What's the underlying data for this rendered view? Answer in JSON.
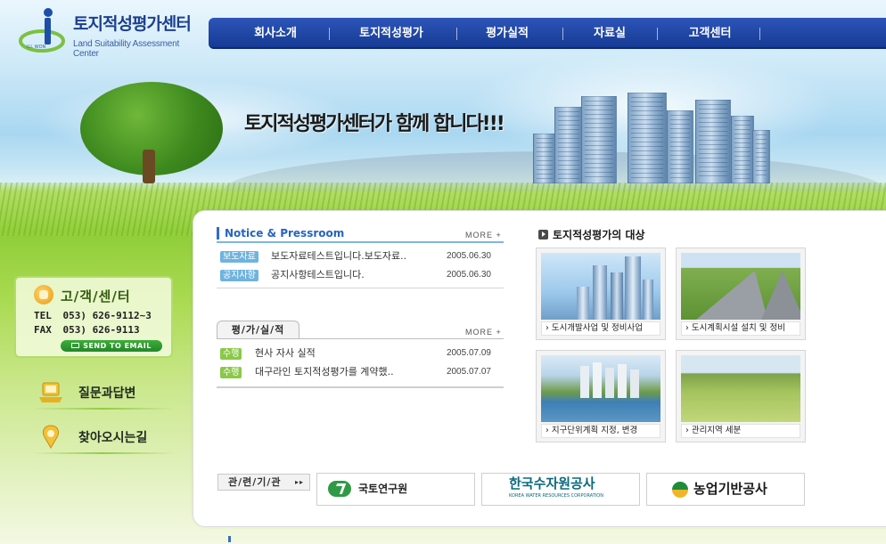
{
  "header": {
    "logo_title": "토지적성평가센터",
    "logo_subtitle": "Land Suitability Assessment Center",
    "logo_mark_text": "ILL WON"
  },
  "nav": {
    "items": [
      {
        "label": "회사소개"
      },
      {
        "label": "토지적성평가"
      },
      {
        "label": "평가실적"
      },
      {
        "label": "자료실"
      },
      {
        "label": "고객센터"
      }
    ]
  },
  "banner": {
    "slogan": "토지적성평가센터가 함께 합니다!!!"
  },
  "customer_center": {
    "title": "고/객/센/터",
    "tel_label": "TEL",
    "tel": "053) 626-9112~3",
    "fax_label": "FAX",
    "fax": "053) 626-9113",
    "email_button": "SEND TO EMAIL"
  },
  "side_links": [
    {
      "label": "질문과답변",
      "icon": "laptop-icon"
    },
    {
      "label": "찾아오시는길",
      "icon": "map-pin-icon"
    }
  ],
  "notice": {
    "title": "Notice & Pressroom",
    "more": "MORE +",
    "items": [
      {
        "tag": "보도자료",
        "text": "보도자료테스트입니다.보도자료..",
        "date": "2005.06.30"
      },
      {
        "tag": "공지사항",
        "text": "공지사항테스트입니다.",
        "date": "2005.06.30"
      }
    ]
  },
  "performance": {
    "title": "평/가/실/적",
    "more": "MORE +",
    "items": [
      {
        "tag": "수행",
        "text": "현사 자사 실적",
        "date": "2005.07.09"
      },
      {
        "tag": "수행",
        "text": "대구라인 토지적성평가를 계약했..",
        "date": "2005.07.07"
      }
    ]
  },
  "targets": {
    "title": "토지적성평가의 대상",
    "items": [
      {
        "caption": "도시개발사업 및 정비사업"
      },
      {
        "caption": "도시계획시설 설치 및 정비"
      },
      {
        "caption": "지구단위계획 지정, 변경"
      },
      {
        "caption": "관리지역 세분"
      }
    ]
  },
  "related": {
    "label": "관/련/기/관",
    "orgs": [
      {
        "name": "국토연구원",
        "color": "#1f1f1f"
      },
      {
        "name": "한국수자원공사",
        "sub": "KOREA WATER RESOURCES CORPORATION",
        "color": "#0a6a7e"
      },
      {
        "name": "농업기반공사",
        "color": "#1a1a1a"
      }
    ]
  },
  "colors": {
    "nav_bg": "#1d44a6",
    "notice_blue": "#2564c3",
    "tag_blue": "#6fb3de",
    "tag_green": "#8ac947",
    "brand_green": "#3eae3a"
  }
}
